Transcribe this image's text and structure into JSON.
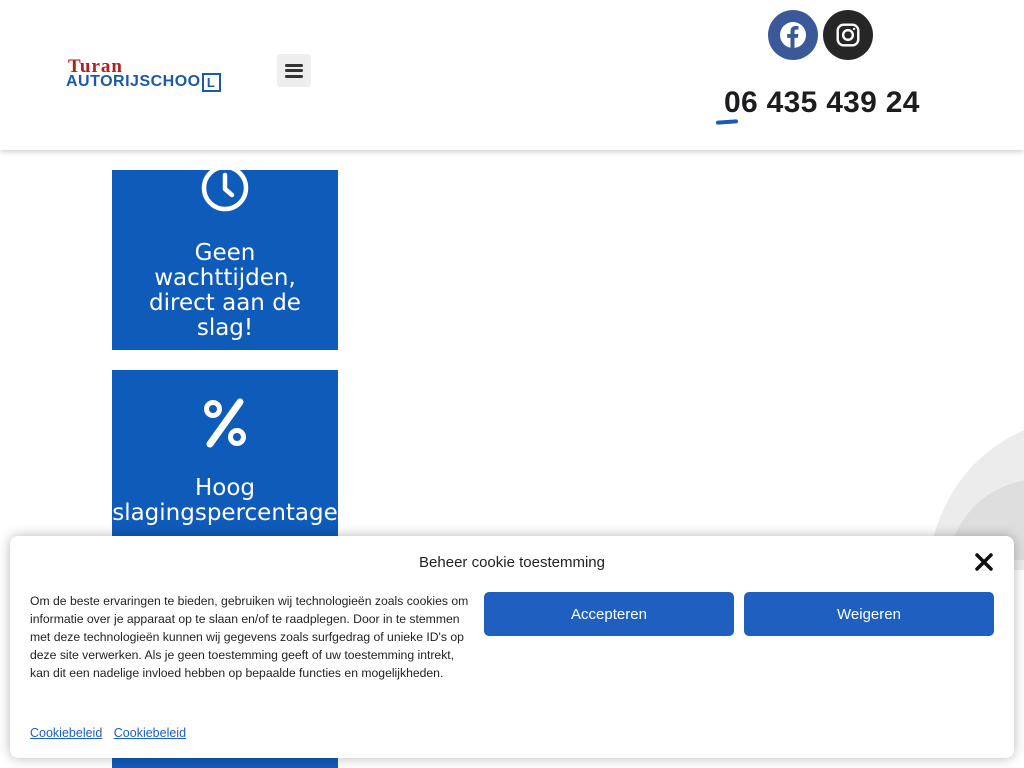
{
  "header": {
    "logo_top": "Turan",
    "logo_bottom": "AUTORIJSCHOO",
    "logo_badge": "L",
    "menu_icon": "hamburger-menu-icon",
    "social": [
      {
        "icon": "facebook-icon",
        "color": "#3b5998"
      },
      {
        "icon": "instagram-icon",
        "color": "#262626"
      }
    ],
    "phone": "06 435 439 24"
  },
  "features": [
    {
      "icon": "clock-icon",
      "text": "Geen\nwachttijden,\ndirect aan de\nslag!"
    },
    {
      "icon": "percent-icon",
      "text": "Hoog\nslagingspercentage"
    }
  ],
  "cookie": {
    "title": "Beheer cookie toestemming",
    "body": "Om de beste ervaringen te bieden, gebruiken wij technologieën zoals cookies om informatie over je apparaat op te slaan en/of te raadplegen. Door in te stemmen met deze technologieën kunnen wij gegevens zoals surfgedrag of unieke ID's op deze site verwerken. Als je geen toestemming geeft of uw toestemming intrekt, kan dit een nadelige invloed hebben op bepaalde functies en mogelijkheden.",
    "accept_label": "Accepteren",
    "deny_label": "Weigeren",
    "links": [
      "Cookiebeleid",
      "Cookiebeleid"
    ]
  },
  "colors": {
    "brand_blue": "#0f5bb9",
    "button_blue": "#1e5fc0",
    "logo_red": "#b3201f"
  }
}
